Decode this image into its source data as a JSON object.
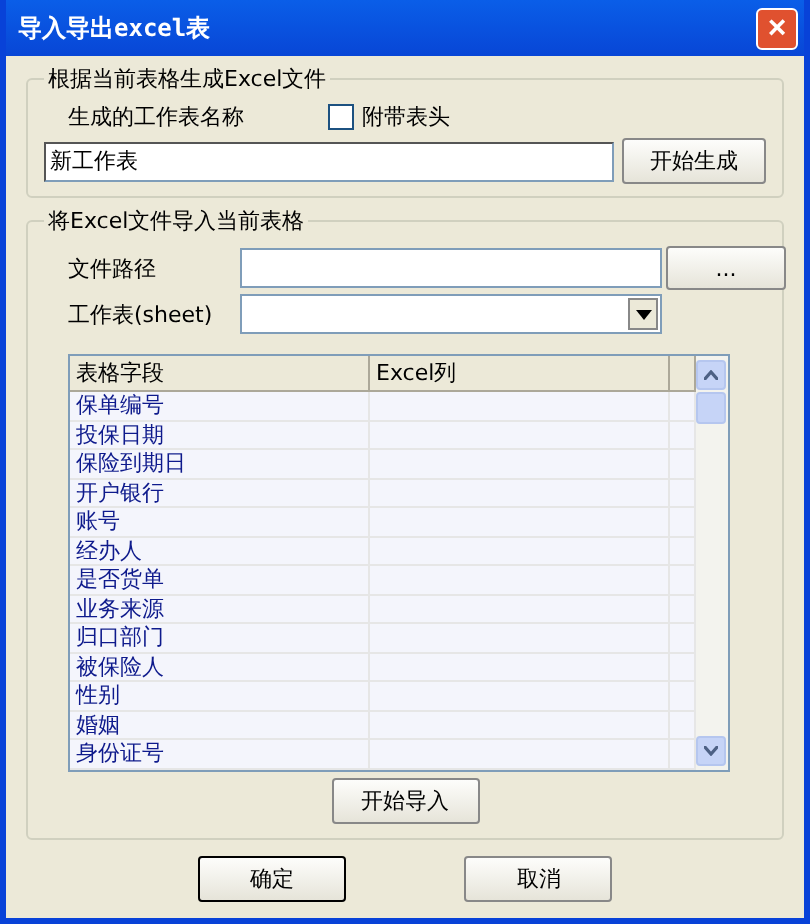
{
  "window": {
    "title": "导入导出excel表",
    "close": "×"
  },
  "export_group": {
    "legend": "根据当前表格生成Excel文件",
    "sheet_name_label": "生成的工作表名称",
    "include_header": {
      "label": "附带表头",
      "checked": false
    },
    "sheet_name_value": "新工作表",
    "generate_button": "开始生成"
  },
  "import_group": {
    "legend": "将Excel文件导入当前表格",
    "file_path_label": "文件路径",
    "browse_button": "...",
    "sheet_label": "工作表(sheet)",
    "table": {
      "columns": [
        "表格字段",
        "Excel列"
      ],
      "rows": [
        {
          "field": "保单编号"
        },
        {
          "field": "投保日期"
        },
        {
          "field": "保险到期日"
        },
        {
          "field": "开户银行"
        },
        {
          "field": "账号"
        },
        {
          "field": "经办人"
        },
        {
          "field": "是否货单"
        },
        {
          "field": "业务来源"
        },
        {
          "field": "归口部门"
        },
        {
          "field": "被保险人"
        },
        {
          "field": "性别"
        },
        {
          "field": "婚姻"
        },
        {
          "field": "身份证号"
        }
      ]
    },
    "import_button": "开始导入"
  },
  "buttons": [
    {
      "label": "确定",
      "default": true
    },
    {
      "label": "取消",
      "default": false
    }
  ]
}
